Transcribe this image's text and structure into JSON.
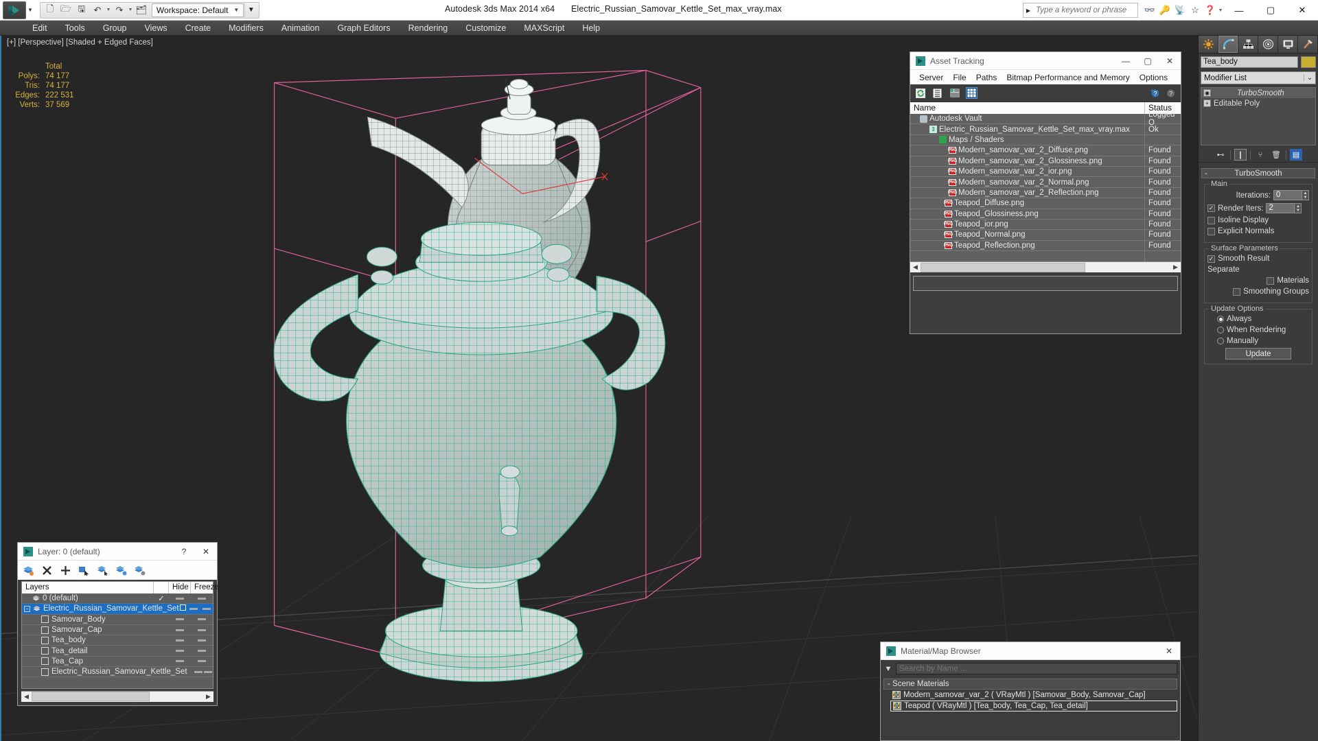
{
  "titlebar": {
    "app_title": "Autodesk 3ds Max  2014 x64",
    "file_title": "Electric_Russian_Samovar_Kettle_Set_max_vray.max",
    "workspace_label": "Workspace: Default",
    "search_placeholder": "Type a keyword or phrase",
    "quick_access": [
      "new-icon",
      "open-icon",
      "save-icon",
      "undo-icon",
      "redo-icon",
      "set-project-icon"
    ],
    "window_buttons": [
      "minimize",
      "maximize",
      "close"
    ],
    "help_icons": [
      "binoculars-icon",
      "key-icon",
      "satellite-icon",
      "star-icon",
      "help-icon"
    ]
  },
  "menubar": {
    "items": [
      "Edit",
      "Tools",
      "Group",
      "Views",
      "Create",
      "Modifiers",
      "Animation",
      "Graph Editors",
      "Rendering",
      "Customize",
      "MAXScript",
      "Help"
    ]
  },
  "viewport": {
    "label": "[+] [Perspective] [Shaded + Edged Faces]",
    "stats": {
      "header": "Total",
      "rows": [
        {
          "label": "Polys:",
          "value": "74 177"
        },
        {
          "label": "Tris:",
          "value": "74 177"
        },
        {
          "label": "Edges:",
          "value": "222 531"
        },
        {
          "label": "Verts:",
          "value": "37 569"
        }
      ]
    },
    "model_color": "#3fcfa8",
    "background": "#262626"
  },
  "command_panel": {
    "tabs": [
      "create-tab",
      "modify-tab",
      "hierarchy-tab",
      "motion-tab",
      "display-tab",
      "utilities-tab"
    ],
    "selected_tab_index": 1,
    "object_name": "Tea_body",
    "object_color": "#c8ae2e",
    "modifier_list_label": "Modifier List",
    "stack": [
      {
        "label": "TurboSmooth",
        "selected": true,
        "italic": true
      },
      {
        "label": "Editable Poly",
        "selected": false,
        "italic": false
      }
    ],
    "rollout": {
      "title": "TurboSmooth",
      "minus": "-",
      "groups": [
        {
          "name": "Main",
          "fields": [
            {
              "type": "spinner",
              "label": "Iterations:",
              "value": "0"
            },
            {
              "type": "checkbox_spinner",
              "label": "Render Iters:",
              "value": "2",
              "checked": true
            },
            {
              "type": "checkbox",
              "label": "Isoline Display",
              "checked": false
            },
            {
              "type": "checkbox",
              "label": "Explicit Normals",
              "checked": false
            }
          ]
        },
        {
          "name": "Surface Parameters",
          "fields": [
            {
              "type": "checkbox",
              "label": "Smooth Result",
              "checked": true
            },
            {
              "type": "text",
              "label": "Separate"
            },
            {
              "type": "checkbox_indent",
              "label": "Materials",
              "checked": false
            },
            {
              "type": "checkbox_indent",
              "label": "Smoothing Groups",
              "checked": false
            }
          ]
        },
        {
          "name": "Update Options",
          "fields": [
            {
              "type": "radio",
              "label": "Always",
              "checked": true
            },
            {
              "type": "radio",
              "label": "When Rendering",
              "checked": false
            },
            {
              "type": "radio",
              "label": "Manually",
              "checked": false
            },
            {
              "type": "button",
              "label": "Update"
            }
          ]
        }
      ]
    }
  },
  "asset_tracking": {
    "title": "Asset Tracking",
    "menus": [
      "Server",
      "File",
      "Paths",
      "Bitmap Performance and Memory",
      "Options"
    ],
    "toolbar_icons": [
      "refresh-icon",
      "list-view-icon",
      "detail-view-icon",
      "grid-view-icon",
      "help-add-icon",
      "help-icon"
    ],
    "columns": [
      "Name",
      "Status"
    ],
    "rows": [
      {
        "name": "Autodesk Vault",
        "status": "Logged O",
        "indent": 1,
        "icon": "vault-icon"
      },
      {
        "name": "Electric_Russian_Samovar_Kettle_Set_max_vray.max",
        "status": "Ok",
        "indent": 2,
        "icon": "max-icon"
      },
      {
        "name": "Maps / Shaders",
        "status": "",
        "indent": 3,
        "icon": "shader-icon"
      },
      {
        "name": "Modern_samovar_var_2_Diffuse.png",
        "status": "Found",
        "indent": 4,
        "icon": "png-icon"
      },
      {
        "name": "Modern_samovar_var_2_Glossiness.png",
        "status": "Found",
        "indent": 4,
        "icon": "png-icon"
      },
      {
        "name": "Modern_samovar_var_2_ior.png",
        "status": "Found",
        "indent": 4,
        "icon": "png-icon"
      },
      {
        "name": "Modern_samovar_var_2_Normal.png",
        "status": "Found",
        "indent": 4,
        "icon": "png-icon"
      },
      {
        "name": "Modern_samovar_var_2_Reflection.png",
        "status": "Found",
        "indent": 4,
        "icon": "png-icon"
      },
      {
        "name": "Teapod_Diffuse.png",
        "status": "Found",
        "indent": 4,
        "icon": "png-icon"
      },
      {
        "name": "Teapod_Glossiness.png",
        "status": "Found",
        "indent": 4,
        "icon": "png-icon"
      },
      {
        "name": "Teapod_ior.png",
        "status": "Found",
        "indent": 4,
        "icon": "png-icon"
      },
      {
        "name": "Teapod_Normal.png",
        "status": "Found",
        "indent": 4,
        "icon": "png-icon"
      },
      {
        "name": "Teapod_Reflection.png",
        "status": "Found",
        "indent": 4,
        "icon": "png-icon"
      }
    ]
  },
  "layer_window": {
    "title": "Layer: 0 (default)",
    "toolbar_icons": [
      "create-layer-icon",
      "delete-layer-icon",
      "add-layer-icon",
      "select-objects-icon",
      "select-highlight-icon",
      "highlight-selected-icon",
      "layer-properties-icon"
    ],
    "columns": [
      "Layers",
      "",
      "Hide",
      "Freeze"
    ],
    "rows": [
      {
        "name": "0 (default)",
        "indent": 1,
        "type": "layer",
        "current": true,
        "selected": false,
        "expander": ""
      },
      {
        "name": "Electric_Russian_Samovar_Kettle_Set",
        "indent": 0,
        "type": "layer",
        "current": false,
        "selected": true,
        "expander": "-"
      },
      {
        "name": "Samovar_Body",
        "indent": 2,
        "type": "object",
        "selected": false,
        "expander": ""
      },
      {
        "name": "Samovar_Cap",
        "indent": 2,
        "type": "object",
        "selected": false,
        "expander": ""
      },
      {
        "name": "Tea_body",
        "indent": 2,
        "type": "object",
        "selected": false,
        "expander": ""
      },
      {
        "name": "Tea_detail",
        "indent": 2,
        "type": "object",
        "selected": false,
        "expander": ""
      },
      {
        "name": "Tea_Cap",
        "indent": 2,
        "type": "object",
        "selected": false,
        "expander": ""
      },
      {
        "name": "Electric_Russian_Samovar_Kettle_Set",
        "indent": 2,
        "type": "object",
        "selected": false,
        "expander": ""
      }
    ]
  },
  "material_browser": {
    "title": "Material/Map Browser",
    "search_placeholder": "Search by Name ...",
    "group_label": "- Scene Materials",
    "materials": [
      {
        "label": "Modern_samovar_var_2  ( VRayMtl )  [Samovar_Body, Samovar_Cap]",
        "selected": false
      },
      {
        "label": "Teapod  ( VRayMtl )  [Tea_body, Tea_Cap, Tea_detail]",
        "selected": true
      }
    ]
  }
}
